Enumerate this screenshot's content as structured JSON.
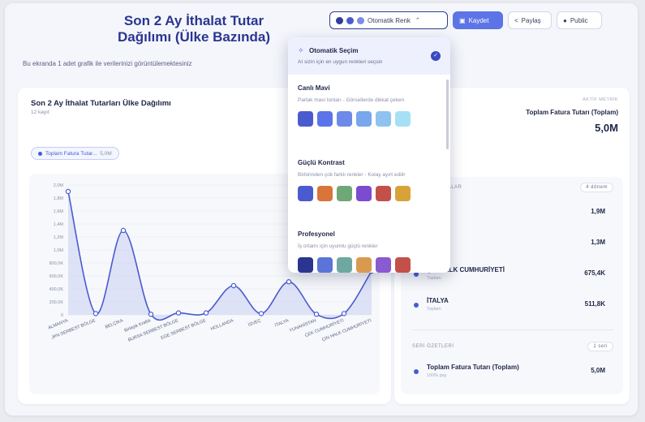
{
  "header": {
    "title": "Son 2 Ay İthalat Tutar Dağılımı (Ülke Bazında)",
    "subtitle": "Bu ekranda 1 adet grafik ile verilerinizi görüntülemektesiniz"
  },
  "toolbar": {
    "color_label": "Otomatik Renk",
    "color_dots": [
      "#2f3c9a",
      "#4a5bd0",
      "#7b8de6"
    ],
    "save_label": "Kaydet",
    "share_label": "Paylaş",
    "public_label": "Public"
  },
  "chart_card": {
    "title": "Son 2 Ay İthalat Tutarları Ülke Dağılımı",
    "count": "12 kayıt",
    "legend_label": "Toplam Fatura Tutar...",
    "legend_value": "5,0M"
  },
  "chart_data": {
    "type": "area",
    "categories": [
      "ALMANYA",
      "JPN SERBEST BÖLGE",
      "BELÇİKA",
      "Birleşik Krallık",
      "BURSA SERBEST BÖLGE",
      "EGE SERBEST BÖLGE",
      "HOLLANDA",
      "İSVEÇ",
      "İTALYA",
      "YUNANİSTAN",
      "ÇEK CUMHURİYETİ",
      "ÇİN HALK CUMHURİYETİ"
    ],
    "series": [
      {
        "name": "Toplam Fatura Tutarı (Toplam)",
        "values": [
          1.9,
          0.02,
          1.3,
          0.01,
          0.03,
          0.03,
          0.45,
          0.02,
          0.51,
          0.01,
          0.02,
          0.675
        ]
      }
    ],
    "y_ticks": [
      "2,0M",
      "1,8M",
      "1,6M",
      "1,4M",
      "1,2M",
      "1,0M",
      "800,0K",
      "600,0K",
      "400,0K",
      "200,0K",
      "0"
    ],
    "ylim": [
      0,
      2.0
    ],
    "grid": true,
    "color": "#4a5bd0"
  },
  "metric": {
    "caption": "AKTİF METRİK",
    "name": "Toplam Fatura Tutarı (Toplam)",
    "value": "5,0M"
  },
  "list": {
    "header": "TALAR",
    "badge": "4 dönem",
    "items": [
      {
        "name": "YA",
        "sub": "",
        "value": "1,9M"
      },
      {
        "name": "",
        "sub": "",
        "value": "1,3M"
      },
      {
        "name": "ÇİN HALK CUMHURİYETİ",
        "sub": "Toplam",
        "value": "675,4K"
      },
      {
        "name": "İTALYA",
        "sub": "Toplam",
        "value": "511,8K"
      }
    ]
  },
  "series_summary": {
    "header": "SERİ ÖZETLERİ",
    "badge": "1 seri",
    "name": "Toplam Fatura Tutarı (Toplam)",
    "sub": "100% pay",
    "value": "5,0M"
  },
  "dropdown": {
    "auto": {
      "name": "Otomatik Seçim",
      "desc": "AI sizin için en uygun renkleri seçsin",
      "check": "✓"
    },
    "palettes": [
      {
        "name": "Canlı Mavi",
        "desc": "Parlak mavi tonları - Görsellerde dikkat çeken",
        "colors": [
          "#4a5bd0",
          "#5b74ea",
          "#6d8ae8",
          "#79a6ec",
          "#8ec3f0",
          "#a6e0f5"
        ]
      },
      {
        "name": "Güçlü Kontrast",
        "desc": "Birbirinden çok farklı renkler - Kolay ayırt edilir",
        "colors": [
          "#4a5bd0",
          "#d9743a",
          "#6fa877",
          "#7b4bd0",
          "#c4504a",
          "#d7a339"
        ]
      },
      {
        "name": "Profesyonel",
        "desc": "İş ortamı için uyumlu güçlü renkler",
        "colors": [
          "#2b3590",
          "#5a74d8",
          "#6fa8a0",
          "#d99a50",
          "#8a5ad0",
          "#c4504a"
        ]
      }
    ]
  }
}
